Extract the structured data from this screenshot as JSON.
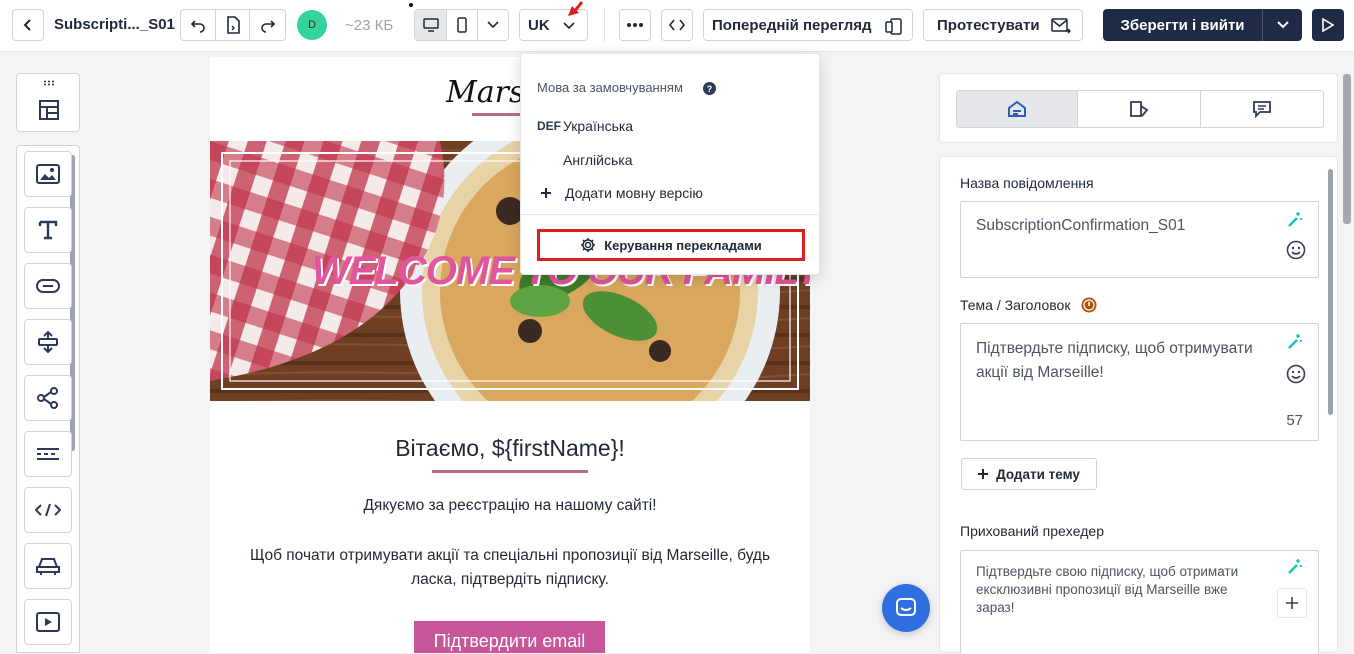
{
  "toolbar": {
    "title": "Subscripti..._S01",
    "avatar_initial": "D",
    "size": "~23 КБ",
    "language": "UK",
    "preview_label": "Попередній перегляд",
    "test_label": "Протестувати",
    "save_exit_label": "Зберегти і вийти"
  },
  "dropdown": {
    "header": "Мова за замовчуванням",
    "def_badge": "DEF",
    "languages": [
      "Українська",
      "Англійська"
    ],
    "add_language": "Додати мовну версію",
    "manage_translations": "Керування перекладами"
  },
  "email": {
    "logo_text": "Marseille",
    "hero_text": "WELCOME TO OUR FAMILY",
    "greeting": "Вітаємо, ${firstName}!",
    "thanks": "Дякуємо за реєстрацію на нашому сайті!",
    "body": "Щоб почати отримувати акції та спеціальні пропозиції від Marseille, будь ласка, підтвердіть підписку.",
    "cta": "Підтвердити email"
  },
  "settings": {
    "message_name_label": "Назва повідомлення",
    "message_name_value": "SubscriptionConfirmation_S01",
    "subject_label": "Тема / Заголовок",
    "subject_value": "Підтвердьте підписку, щоб отримувати акції від Marseille!",
    "subject_count": "57",
    "add_subject_label": "Додати тему",
    "preheader_label": "Прихований преxедер",
    "preheader_value": "Підтвердьте свою підписку, щоб отримати ексклюзивні пропозиції від Marseille вже зараз!"
  },
  "colors": {
    "primary_dark": "#1f2a44",
    "accent_pink": "#c9559b",
    "highlight_red": "#e11d1d",
    "teal": "#14c9b0",
    "avatar_green": "#34d399",
    "chat_blue": "#2f6fe0"
  },
  "icons": [
    "back-arrow-icon",
    "undo-icon",
    "document-icon",
    "redo-icon",
    "desktop-icon",
    "mobile-icon",
    "chevron-down-icon",
    "more-icon",
    "code-icon",
    "mobile-preview-icon",
    "send-mail-icon",
    "play-icon",
    "drag-handle-icon",
    "layout-icon",
    "image-icon",
    "text-icon",
    "button-icon",
    "spacer-icon",
    "social-icon",
    "divider-icon",
    "html-icon",
    "product-icon",
    "video-icon",
    "help-icon",
    "plus-icon",
    "gear-icon",
    "magic-wand-icon",
    "emoji-icon",
    "chat-icon",
    "info-icon"
  ]
}
